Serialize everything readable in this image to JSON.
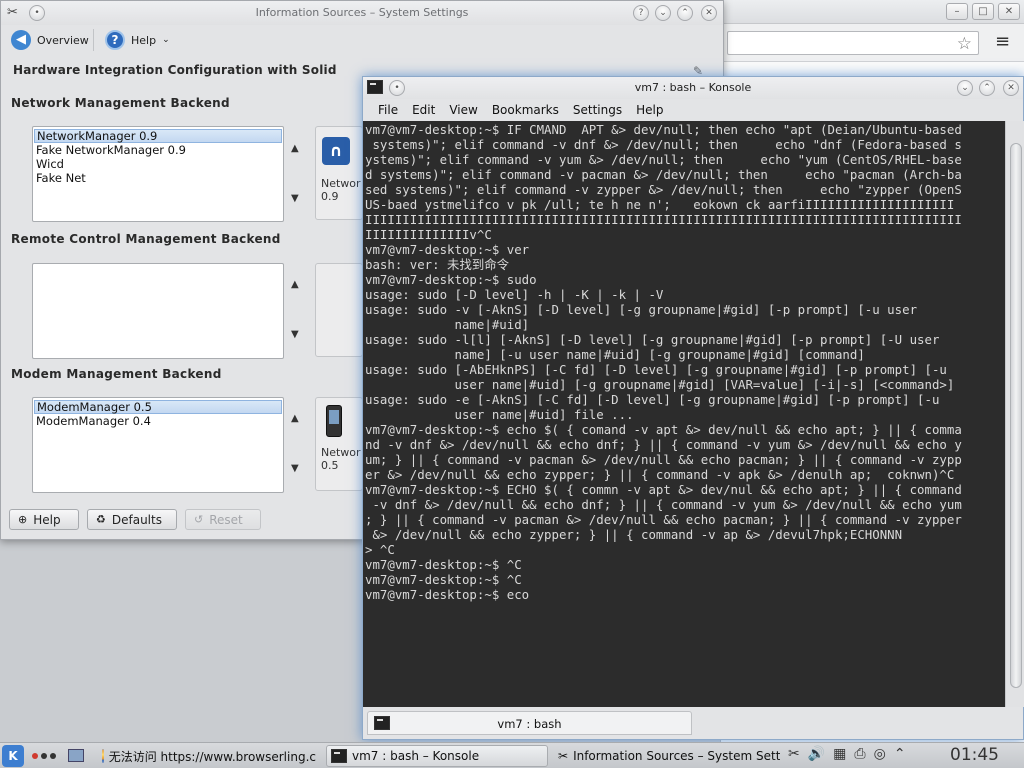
{
  "browser": {
    "minimize": "–",
    "maximize": "□",
    "close": "✕",
    "menu_icon": "≡",
    "star": "☆"
  },
  "settings": {
    "title": "Information Sources – System Settings",
    "toolbar": {
      "overview": "Overview",
      "help": "Help"
    },
    "heading": "Hardware Integration Configuration with Solid",
    "network": {
      "title": "Network Management Backend",
      "items": [
        "NetworkManager 0.9",
        "Fake NetworkManager 0.9",
        "Wicd",
        "Fake Net"
      ],
      "preview_label": "Networ",
      "preview_version": "0.9"
    },
    "remote": {
      "title": "Remote Control Management Backend",
      "items": []
    },
    "modem": {
      "title": "Modem Management Backend",
      "items": [
        "ModemManager 0.5",
        "ModemManager 0.4"
      ],
      "preview_label": "Networ",
      "preview_version": "0.5"
    },
    "buttons": {
      "help": "Help",
      "defaults": "Defaults",
      "reset": "Reset"
    }
  },
  "konsole": {
    "title": "vm7 : bash – Konsole",
    "menu": [
      "File",
      "Edit",
      "View",
      "Bookmarks",
      "Settings",
      "Help"
    ],
    "tab_label": "vm7 : bash",
    "lines": [
      "vm7@vm7-desktop:~$ IF CMAND  APT &> dev/null; then echo \"apt (Deian/Ubuntu-based",
      " systems)\"; elif command -v dnf &> /dev/null; then     echo \"dnf (Fedora-based s",
      "ystems)\"; elif command -v yum &> /dev/null; then     echo \"yum (CentOS/RHEL-base",
      "d systems)\"; elif command -v pacman &> /dev/null; then     echo \"pacman (Arch-ba",
      "sed systems)\"; elif command -v zypper &> /dev/null; then     echo \"zypper (OpenS",
      "US-baed ystmelifco v pk /ull; te h ne n';   eokown ck aarfiIIIIIIIIIIIIIIIIIIII",
      "IIIIIIIIIIIIIIIIIIIIIIIIIIIIIIIIIIIIIIIIIIIIIIIIIIIIIIIIIIIIIIIIIIIIIIIIIIIIIIII",
      "IIIIIIIIIIIIIIv^C",
      "vm7@vm7-desktop:~$ ver",
      "bash: ver: 未找到命令",
      "vm7@vm7-desktop:~$ sudo",
      "usage: sudo [-D level] -h | -K | -k | -V",
      "usage: sudo -v [-AknS] [-D level] [-g groupname|#gid] [-p prompt] [-u user",
      "            name|#uid]",
      "usage: sudo -l[l] [-AknS] [-D level] [-g groupname|#gid] [-p prompt] [-U user",
      "            name] [-u user name|#uid] [-g groupname|#gid] [command]",
      "usage: sudo [-AbEHknPS] [-C fd] [-D level] [-g groupname|#gid] [-p prompt] [-u",
      "            user name|#uid] [-g groupname|#gid] [VAR=value] [-i|-s] [<command>]",
      "usage: sudo -e [-AknS] [-C fd] [-D level] [-g groupname|#gid] [-p prompt] [-u",
      "            user name|#uid] file ...",
      "vm7@vm7-desktop:~$ echo $( { comand -v apt &> dev/null && echo apt; } || { comma",
      "nd -v dnf &> /dev/null && echo dnf; } || { command -v yum &> /dev/null && echo y",
      "um; } || { command -v pacman &> /dev/null && echo pacman; } || { command -v zypp",
      "er &> /dev/null && echo zypper; } || { command -v apk &> /denulh ap;  coknwn)^C",
      "vm7@vm7-desktop:~$ ECHO $( { commn -v apt &> dev/nul && echo apt; } || { command",
      " -v dnf &> /dev/null && echo dnf; } || { command -v yum &> /dev/null && echo yum",
      "; } || { command -v pacman &> /dev/null && echo pacman; } || { command -v zypper",
      " &> /dev/null && echo zypper; } || { command -v ap &> /devul7hpk;ECHONNN",
      "> ^C",
      "vm7@vm7-desktop:~$ ^C",
      "vm7@vm7-desktop:~$ ^C",
      "vm7@vm7-desktop:~$ eco"
    ]
  },
  "taskbar": {
    "tasks": [
      "无法访问 https://www.browserling.c",
      "vm7 : bash – Konsole",
      "Information Sources – System Setti"
    ],
    "clock": "01:45",
    "colors": {
      "dot1": "#d03a2f",
      "dot2": "#333333",
      "dot3": "#333333",
      "accent": "#3d7ed0"
    }
  }
}
